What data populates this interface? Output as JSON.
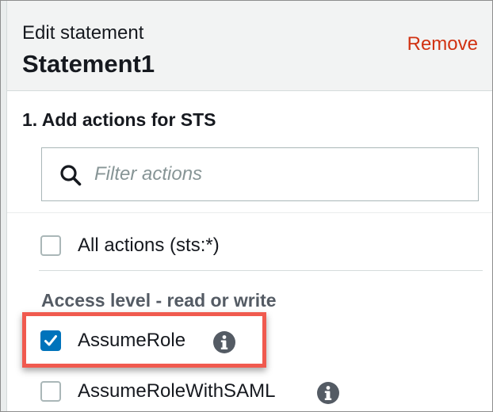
{
  "header": {
    "subtitle": "Edit statement",
    "title": "Statement1",
    "remove_label": "Remove"
  },
  "section": {
    "title": "1. Add actions for STS"
  },
  "search": {
    "placeholder": "Filter actions",
    "value": ""
  },
  "actions": {
    "all_actions_label": "All actions (sts:*)",
    "all_actions_checked": false,
    "group_title": "Access level - read or write",
    "items": [
      {
        "label": "AssumeRole",
        "checked": true,
        "info_icon": "info-icon"
      },
      {
        "label": "AssumeRoleWithSAML",
        "checked": false,
        "info_icon": "info-icon"
      }
    ]
  },
  "colors": {
    "accent_blue": "#0073bb",
    "remove_red": "#d13212",
    "highlight_red": "#f05a4f",
    "header_bg": "#f2f3f3",
    "group_title_gray": "#545b64"
  }
}
